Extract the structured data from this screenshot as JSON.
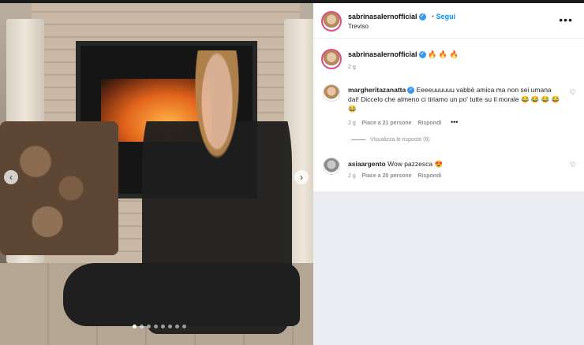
{
  "post": {
    "username": "sabrinasalernofficial",
    "follow_label": "Segui",
    "location": "Treviso",
    "more_label": "•••",
    "caption_emojis": "🔥 🔥 🔥",
    "caption_time": "2 g"
  },
  "carousel": {
    "prev_label": "‹",
    "next_label": "›",
    "dots": 8,
    "active_dot": 0
  },
  "comments": [
    {
      "username": "margheritazanatta",
      "text": "Eeeeuuuuuu vabbè amica ma non sei umana dai! Diccelo che almeno ci tiriamo un po' tutte su il morale 😂 😂 😂 😂 😂",
      "time": "2 g",
      "likes": "Piace a 21 persone",
      "reply": "Rispondi",
      "options": "•••",
      "view_replies": "Visualizza le risposte (6)"
    },
    {
      "username": "asiaargento",
      "text": "Wow pazzesca 😍",
      "time": "2 g",
      "likes": "Piace a 20 persone",
      "reply": "Rispondi"
    }
  ],
  "icons": {
    "heart": "♡",
    "verified": "✓"
  }
}
